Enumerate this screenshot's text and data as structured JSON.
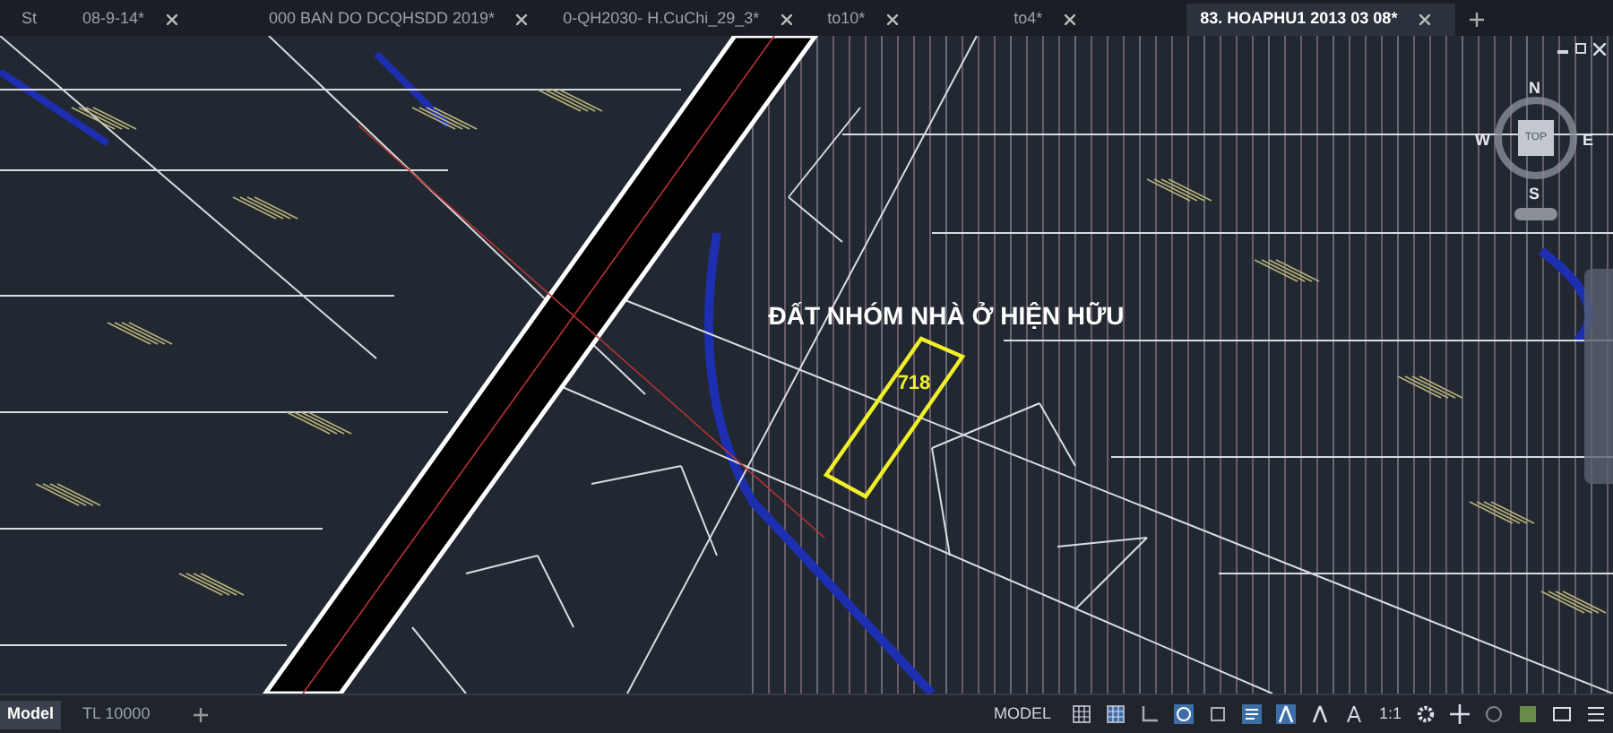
{
  "file_tabs": [
    {
      "label": "St",
      "selected": false
    },
    {
      "label": "08-9-14*",
      "selected": false
    },
    {
      "label": "000 BAN DO DCQHSDD 2019*",
      "selected": false
    },
    {
      "label": "0-QH2030- H.CuChi_29_3*",
      "selected": false
    },
    {
      "label": "to10*",
      "selected": false
    },
    {
      "label": "to4*",
      "selected": false
    },
    {
      "label": "83. HOAPHU1 2013 03 08*",
      "selected": true
    }
  ],
  "drawing": {
    "zone_label": "ĐẤT NHÓM NHÀ Ở HIỆN HỮU",
    "parcel_number": "718"
  },
  "view_cube": {
    "top": "TOP",
    "north": "N",
    "south": "S",
    "east": "E",
    "west": "W"
  },
  "layout_tabs": [
    {
      "label": "Model",
      "selected": true
    },
    {
      "label": "TL 10000",
      "selected": false
    }
  ],
  "status_bar": {
    "space": "MODEL",
    "scale": "1:1"
  }
}
